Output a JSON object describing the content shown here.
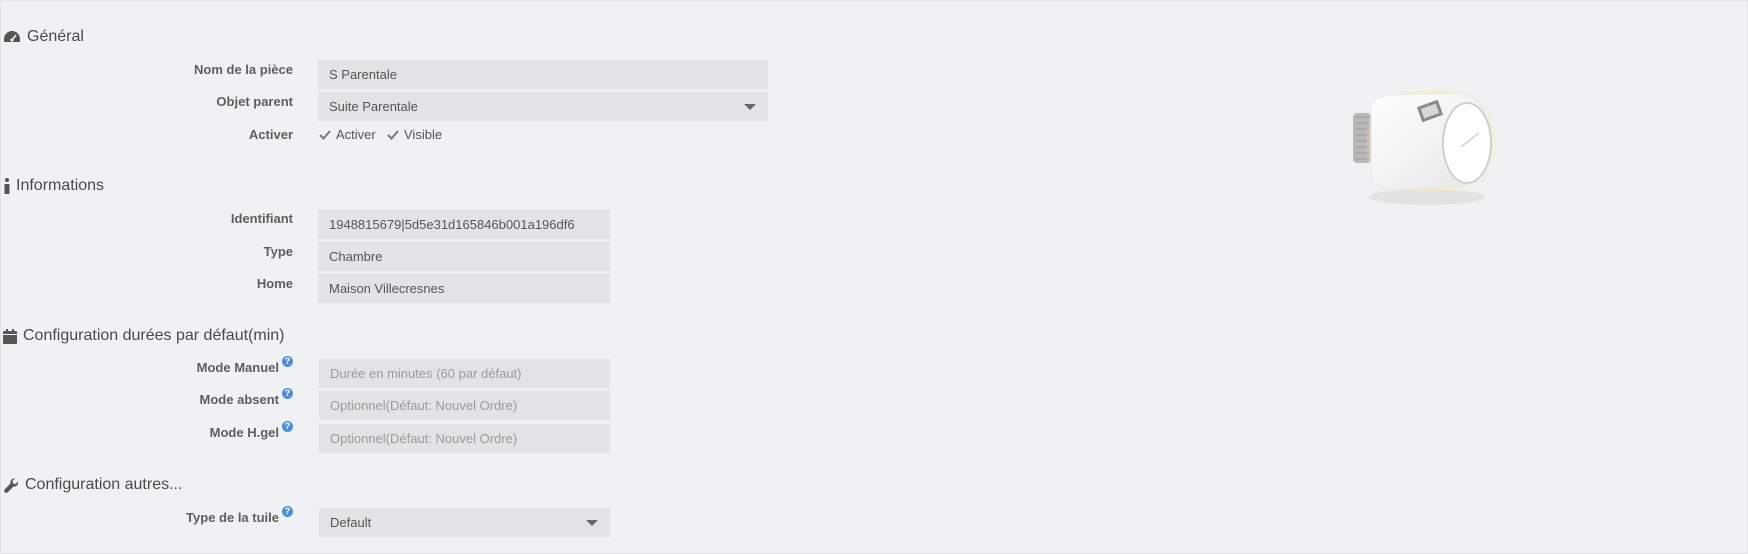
{
  "general": {
    "title": "Général",
    "room_name_label": "Nom de la pièce",
    "room_name_value": "S Parentale",
    "parent_label": "Objet parent",
    "parent_value": "Suite Parentale",
    "activate_label": "Activer",
    "activate_check_label": "Activer",
    "visible_check_label": "Visible"
  },
  "informations": {
    "title": "Informations",
    "id_label": "Identifiant",
    "id_value": "1948815679|5d5e31d165846b001a196df6",
    "type_label": "Type",
    "type_value": "Chambre",
    "home_label": "Home",
    "home_value": "Maison Villecresnes"
  },
  "durations": {
    "title": "Configuration durées par défaut(min)",
    "manual_label": "Mode Manuel",
    "manual_placeholder": "Durée en minutes (60 par défaut)",
    "absent_label": "Mode absent",
    "absent_placeholder": "Optionnel(Défaut: Nouvel Ordre)",
    "hgel_label": "Mode H.gel",
    "hgel_placeholder": "Optionnel(Défaut: Nouvel Ordre)",
    "help_glyph": "?"
  },
  "others": {
    "title": "Configuration autres...",
    "tile_label": "Type de la tuile",
    "tile_value": "Default"
  },
  "colors": {
    "background": "#f0f1f3",
    "field": "#e2e3e4",
    "help_icon": "#4f8fd6"
  }
}
